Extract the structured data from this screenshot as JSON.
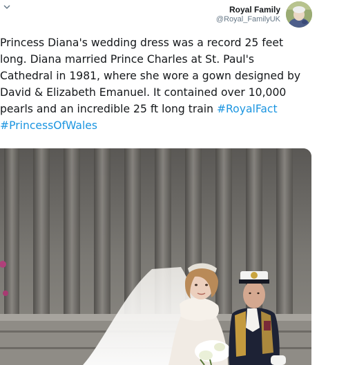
{
  "author": {
    "name": "Royal Family",
    "handle": "@Royal_FamilyUK"
  },
  "icons": {
    "header": "chevron-down-icon",
    "avatar": "avatar"
  },
  "tweet": {
    "lines": [
      "Princess Diana's wedding dress was a record 25 feet",
      "long. Diana married Prince Charles at St. Paul's",
      "Cathedral in 1981, where she wore a gown designed by",
      "David & Elizabeth Emanuel. It contained over 10,000"
    ],
    "line5_text": "pearls and an incredible 25 ft long train ",
    "hashtag_1": "#RoyalFact",
    "hashtag_2": "#PrincessOfWales"
  },
  "colors": {
    "hashtag": "#1b95e0",
    "text": "#14171a",
    "handle": "#657786"
  }
}
